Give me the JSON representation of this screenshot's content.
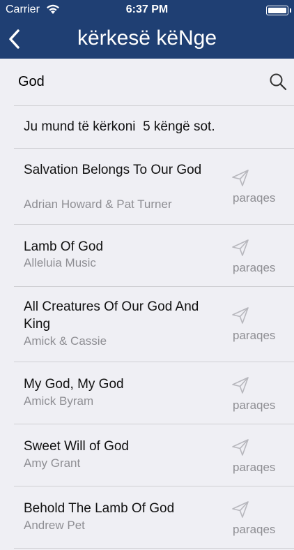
{
  "status_bar": {
    "carrier": "Carrier",
    "time": "6:37 PM"
  },
  "header": {
    "title": "kërkesë këNge"
  },
  "search": {
    "value": "God",
    "placeholder": ""
  },
  "info": {
    "text": "Ju mund të kërkoni  5 këngë sot."
  },
  "request_label": "paraqes",
  "songs": [
    {
      "title": "Salvation Belongs To Our God",
      "artist": "Adrian Howard & Pat Turner"
    },
    {
      "title": "Lamb Of God",
      "artist": "Alleluia Music"
    },
    {
      "title": "All Creatures Of Our God And King",
      "artist": "Amick & Cassie"
    },
    {
      "title": "My God, My God",
      "artist": "Amick Byram"
    },
    {
      "title": "Sweet Will of God",
      "artist": "Amy Grant"
    },
    {
      "title": "Behold The Lamb Of God",
      "artist": "Andrew Pet"
    }
  ],
  "colors": {
    "header": "#1f3f73",
    "background": "#efeff4",
    "secondary_text": "#8e8e93"
  },
  "icons": {
    "back": "chevron-left-icon",
    "search": "search-icon",
    "request": "paper-plane-icon"
  }
}
